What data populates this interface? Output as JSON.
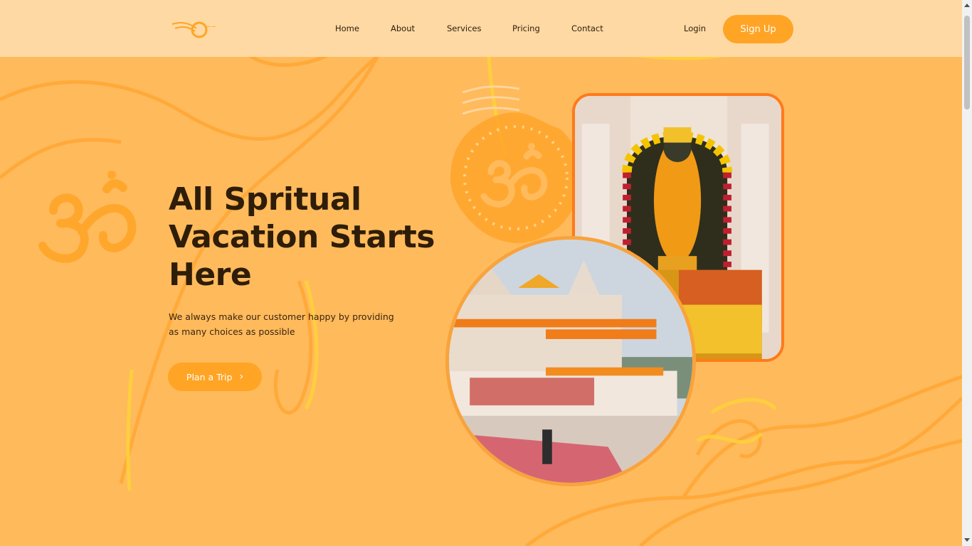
{
  "nav": {
    "logo_alt": "Om logo",
    "links": [
      "Home",
      "About",
      "Services",
      "Pricing",
      "Contact"
    ],
    "login": "Login",
    "signup": "Sign Up"
  },
  "hero": {
    "title_lines": [
      "All Spritual",
      "Vacation Starts",
      "Here"
    ],
    "subtitle_lines": [
      "We always make our customer happy by providing",
      "as many choices as possible"
    ],
    "cta_label": "Plan a Trip",
    "cta_icon": "chevron-right-icon"
  },
  "images": {
    "idol": "ram-lalla-idol-photo",
    "temple": "ram-mandir-temple-photo",
    "om_symbol": "om-icon",
    "seal": "om-seal-icon"
  },
  "colors": {
    "background": "#ffba5c",
    "navbar": "#ffd9a3",
    "accent": "#ffa424",
    "card_border": "#ff7a1a",
    "text": "#2e1d08"
  }
}
